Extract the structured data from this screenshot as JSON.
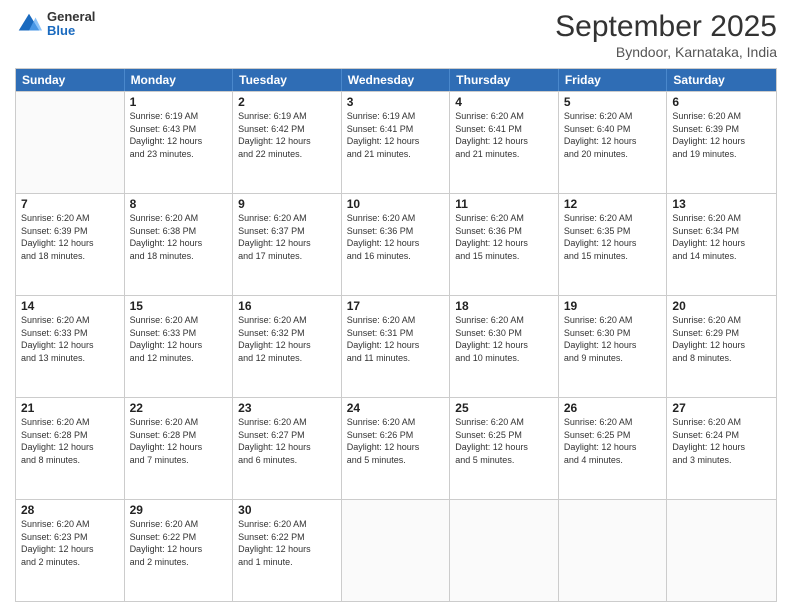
{
  "header": {
    "title": "September 2025",
    "subtitle": "Byndoor, Karnataka, India",
    "logo_general": "General",
    "logo_blue": "Blue"
  },
  "days_of_week": [
    "Sunday",
    "Monday",
    "Tuesday",
    "Wednesday",
    "Thursday",
    "Friday",
    "Saturday"
  ],
  "weeks": [
    [
      {
        "day": "",
        "info": ""
      },
      {
        "day": "1",
        "info": "Sunrise: 6:19 AM\nSunset: 6:43 PM\nDaylight: 12 hours\nand 23 minutes."
      },
      {
        "day": "2",
        "info": "Sunrise: 6:19 AM\nSunset: 6:42 PM\nDaylight: 12 hours\nand 22 minutes."
      },
      {
        "day": "3",
        "info": "Sunrise: 6:19 AM\nSunset: 6:41 PM\nDaylight: 12 hours\nand 21 minutes."
      },
      {
        "day": "4",
        "info": "Sunrise: 6:20 AM\nSunset: 6:41 PM\nDaylight: 12 hours\nand 21 minutes."
      },
      {
        "day": "5",
        "info": "Sunrise: 6:20 AM\nSunset: 6:40 PM\nDaylight: 12 hours\nand 20 minutes."
      },
      {
        "day": "6",
        "info": "Sunrise: 6:20 AM\nSunset: 6:39 PM\nDaylight: 12 hours\nand 19 minutes."
      }
    ],
    [
      {
        "day": "7",
        "info": "Sunrise: 6:20 AM\nSunset: 6:39 PM\nDaylight: 12 hours\nand 18 minutes."
      },
      {
        "day": "8",
        "info": "Sunrise: 6:20 AM\nSunset: 6:38 PM\nDaylight: 12 hours\nand 18 minutes."
      },
      {
        "day": "9",
        "info": "Sunrise: 6:20 AM\nSunset: 6:37 PM\nDaylight: 12 hours\nand 17 minutes."
      },
      {
        "day": "10",
        "info": "Sunrise: 6:20 AM\nSunset: 6:36 PM\nDaylight: 12 hours\nand 16 minutes."
      },
      {
        "day": "11",
        "info": "Sunrise: 6:20 AM\nSunset: 6:36 PM\nDaylight: 12 hours\nand 15 minutes."
      },
      {
        "day": "12",
        "info": "Sunrise: 6:20 AM\nSunset: 6:35 PM\nDaylight: 12 hours\nand 15 minutes."
      },
      {
        "day": "13",
        "info": "Sunrise: 6:20 AM\nSunset: 6:34 PM\nDaylight: 12 hours\nand 14 minutes."
      }
    ],
    [
      {
        "day": "14",
        "info": "Sunrise: 6:20 AM\nSunset: 6:33 PM\nDaylight: 12 hours\nand 13 minutes."
      },
      {
        "day": "15",
        "info": "Sunrise: 6:20 AM\nSunset: 6:33 PM\nDaylight: 12 hours\nand 12 minutes."
      },
      {
        "day": "16",
        "info": "Sunrise: 6:20 AM\nSunset: 6:32 PM\nDaylight: 12 hours\nand 12 minutes."
      },
      {
        "day": "17",
        "info": "Sunrise: 6:20 AM\nSunset: 6:31 PM\nDaylight: 12 hours\nand 11 minutes."
      },
      {
        "day": "18",
        "info": "Sunrise: 6:20 AM\nSunset: 6:30 PM\nDaylight: 12 hours\nand 10 minutes."
      },
      {
        "day": "19",
        "info": "Sunrise: 6:20 AM\nSunset: 6:30 PM\nDaylight: 12 hours\nand 9 minutes."
      },
      {
        "day": "20",
        "info": "Sunrise: 6:20 AM\nSunset: 6:29 PM\nDaylight: 12 hours\nand 8 minutes."
      }
    ],
    [
      {
        "day": "21",
        "info": "Sunrise: 6:20 AM\nSunset: 6:28 PM\nDaylight: 12 hours\nand 8 minutes."
      },
      {
        "day": "22",
        "info": "Sunrise: 6:20 AM\nSunset: 6:28 PM\nDaylight: 12 hours\nand 7 minutes."
      },
      {
        "day": "23",
        "info": "Sunrise: 6:20 AM\nSunset: 6:27 PM\nDaylight: 12 hours\nand 6 minutes."
      },
      {
        "day": "24",
        "info": "Sunrise: 6:20 AM\nSunset: 6:26 PM\nDaylight: 12 hours\nand 5 minutes."
      },
      {
        "day": "25",
        "info": "Sunrise: 6:20 AM\nSunset: 6:25 PM\nDaylight: 12 hours\nand 5 minutes."
      },
      {
        "day": "26",
        "info": "Sunrise: 6:20 AM\nSunset: 6:25 PM\nDaylight: 12 hours\nand 4 minutes."
      },
      {
        "day": "27",
        "info": "Sunrise: 6:20 AM\nSunset: 6:24 PM\nDaylight: 12 hours\nand 3 minutes."
      }
    ],
    [
      {
        "day": "28",
        "info": "Sunrise: 6:20 AM\nSunset: 6:23 PM\nDaylight: 12 hours\nand 2 minutes."
      },
      {
        "day": "29",
        "info": "Sunrise: 6:20 AM\nSunset: 6:22 PM\nDaylight: 12 hours\nand 2 minutes."
      },
      {
        "day": "30",
        "info": "Sunrise: 6:20 AM\nSunset: 6:22 PM\nDaylight: 12 hours\nand 1 minute."
      },
      {
        "day": "",
        "info": ""
      },
      {
        "day": "",
        "info": ""
      },
      {
        "day": "",
        "info": ""
      },
      {
        "day": "",
        "info": ""
      }
    ]
  ]
}
